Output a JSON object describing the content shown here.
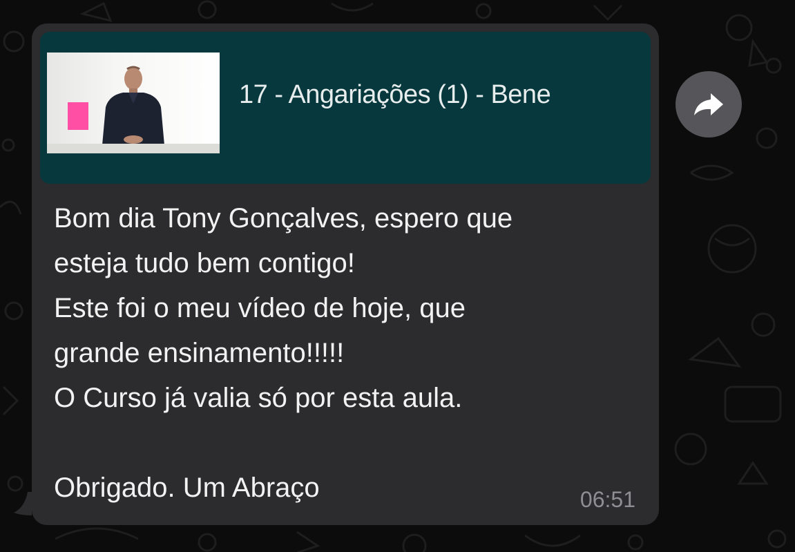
{
  "message": {
    "link_preview": {
      "title": "17 - Angariações (1) - Bene",
      "thumbnail": "video-thumbnail"
    },
    "lines": [
      "Bom dia Tony Gonçalves, espero que",
      "esteja tudo bem contigo!",
      "Este foi o meu vídeo de hoje, que",
      "grande ensinamento!!!!!",
      "O Curso já valia só por esta aula.",
      "",
      "Obrigado. Um Abraço"
    ],
    "time": "06:51"
  },
  "actions": {
    "forward_icon": "forward-arrow-icon"
  },
  "colors": {
    "bubble": "#2c2c2e",
    "preview_bg": "#07383d",
    "text": "#f2f2f2",
    "timestamp": "#8e8e93",
    "background": "#0c0c0c"
  }
}
